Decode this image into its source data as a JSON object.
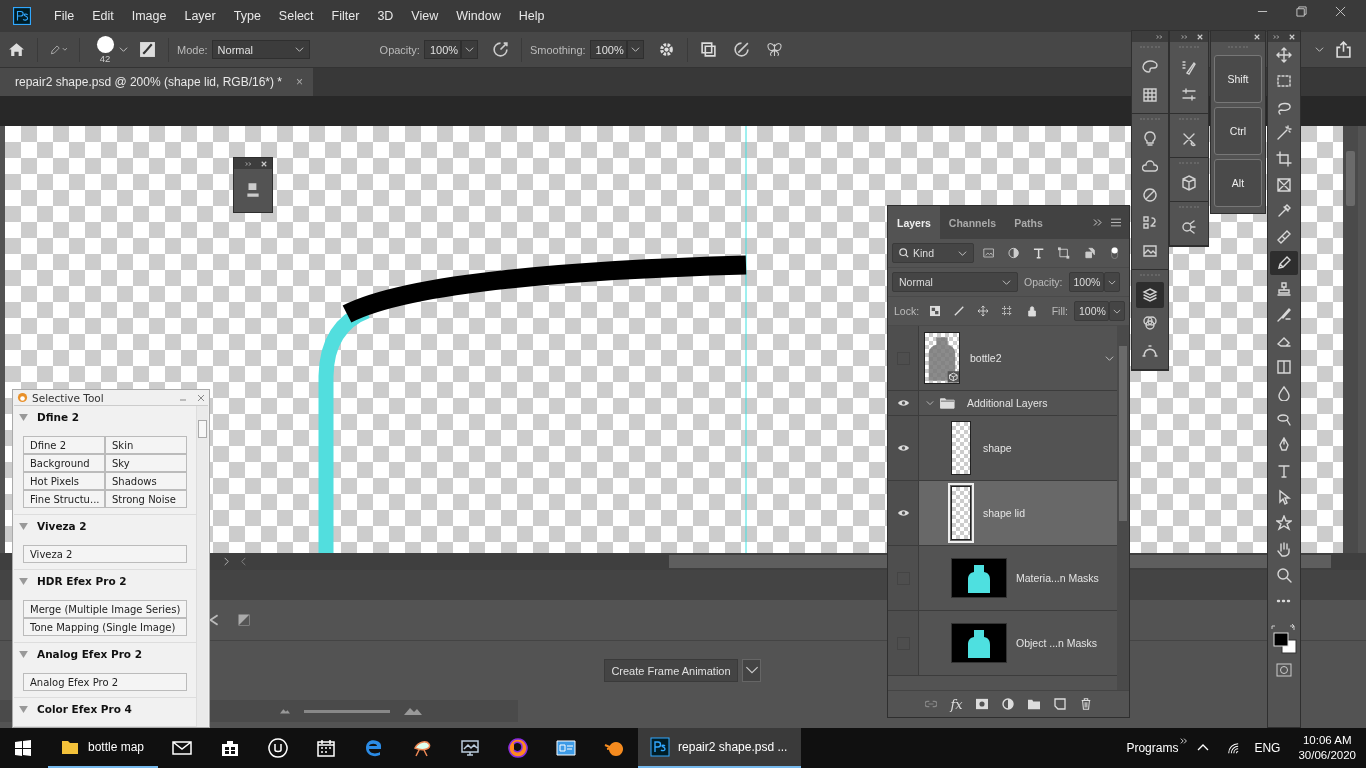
{
  "menu": [
    "File",
    "Edit",
    "Image",
    "Layer",
    "Type",
    "Select",
    "Filter",
    "3D",
    "View",
    "Window",
    "Help"
  ],
  "options_bar": {
    "brush_size": "42",
    "mode_label": "Mode:",
    "mode": "Normal",
    "opacity_label": "Opacity:",
    "opacity": "100%",
    "smoothing_label": "Smoothing:",
    "smoothing": "100%"
  },
  "document_tab": {
    "title": "repair2 shape.psd @ 200% (shape lid, RGB/16*) *",
    "close": "×"
  },
  "timeline": {
    "button": "Create Frame Animation",
    "zoom_slider": {
      "level": 1
    }
  },
  "selective_tool": {
    "title": "Selective Tool",
    "sections": [
      {
        "name": "Dfine 2",
        "buttons": [
          "Dfine 2",
          "Skin",
          "Background",
          "Sky",
          "Hot Pixels",
          "Shadows",
          "Fine Structu...",
          "Strong Noise"
        ]
      },
      {
        "name": "Viveza 2",
        "buttons": [
          "Viveza 2"
        ]
      },
      {
        "name": "HDR Efex Pro 2",
        "buttons": [
          "Merge (Multiple Image Series)",
          "Tone Mapping (Single Image)"
        ]
      },
      {
        "name": "Analog Efex Pro 2",
        "buttons": [
          "Analog Efex Pro 2"
        ]
      },
      {
        "name": "Color Efex Pro 4"
      }
    ]
  },
  "layers_panel": {
    "tabs": [
      {
        "label": "Layers",
        "selected": true
      },
      {
        "label": "Channels",
        "selected": false
      },
      {
        "label": "Paths",
        "selected": false
      }
    ],
    "filter": "Kind",
    "blend_mode": "Normal",
    "opacity_label": "Opacity:",
    "opacity": "100%",
    "lock_label": "Lock:",
    "fill_label": "Fill:",
    "fill": "100%",
    "footer_fx": "fx",
    "layers": [
      {
        "name": "bottle2",
        "kind": "smart",
        "visible": false,
        "selected": false
      },
      {
        "name": "Additional Layers",
        "kind": "group",
        "visible": true,
        "expanded": true,
        "selected": false,
        "children": [
          {
            "name": "shape",
            "kind": "pixel",
            "visible": true,
            "selected": false
          },
          {
            "name": "shape lid",
            "kind": "pixel",
            "visible": true,
            "selected": true
          },
          {
            "name": "Materia...n Masks",
            "kind": "mask",
            "visible": false,
            "selected": false
          },
          {
            "name": "Object ...n Masks",
            "kind": "mask",
            "visible": false,
            "selected": false
          }
        ]
      }
    ]
  },
  "panel_dock": {
    "column_1": [
      {
        "icons": [
          {
            "kind": "palette",
            "selected": false
          },
          {
            "kind": "grid",
            "selected": false
          }
        ]
      },
      {
        "icons": [
          {
            "kind": "bulb",
            "selected": false
          },
          {
            "kind": "cloud",
            "selected": false
          },
          {
            "kind": "halfcircle",
            "selected": false
          },
          {
            "kind": "history",
            "selected": false
          },
          {
            "kind": "picture",
            "selected": false
          }
        ]
      },
      {
        "icons": [
          {
            "kind": "layers",
            "selected": true
          },
          {
            "kind": "channels",
            "selected": false
          },
          {
            "kind": "paths",
            "selected": false
          }
        ]
      }
    ],
    "column_2": [
      {
        "icons": [
          {
            "kind": "brushlist",
            "selected": false
          },
          {
            "kind": "sliders",
            "selected": false
          }
        ]
      },
      {
        "icons": [
          {
            "kind": "tools",
            "selected": false
          }
        ]
      },
      {
        "icons": [
          {
            "kind": "cube",
            "selected": false
          }
        ]
      },
      {
        "icons": [
          {
            "kind": "network",
            "selected": false
          }
        ]
      }
    ]
  },
  "modifier_keys": [
    "Shift",
    "Ctrl",
    "Alt"
  ],
  "toolbar": {
    "tools": [
      {
        "kind": "move",
        "selected": false
      },
      {
        "kind": "marquee",
        "selected": false
      },
      {
        "kind": "lasso",
        "selected": false
      },
      {
        "kind": "wand",
        "selected": false
      },
      {
        "kind": "crop",
        "selected": false
      },
      {
        "kind": "frame",
        "selected": false
      },
      {
        "kind": "eyedropper",
        "selected": false
      },
      {
        "kind": "healing",
        "selected": false
      },
      {
        "kind": "pencil",
        "selected": true
      },
      {
        "kind": "stamp",
        "selected": false
      },
      {
        "kind": "historybrush",
        "selected": false
      },
      {
        "kind": "eraser",
        "selected": false
      },
      {
        "kind": "gradient",
        "selected": false
      },
      {
        "kind": "drop",
        "selected": false
      },
      {
        "kind": "dodge",
        "selected": false
      },
      {
        "kind": "pen",
        "selected": false
      },
      {
        "kind": "type",
        "selected": false
      },
      {
        "kind": "arrow",
        "selected": false
      },
      {
        "kind": "star",
        "selected": false
      },
      {
        "kind": "hand",
        "selected": false
      },
      {
        "kind": "zoom",
        "selected": false
      },
      {
        "kind": "more",
        "selected": false
      }
    ]
  },
  "taskbar": {
    "apps": [
      {
        "kind": "folder",
        "label": "bottle map",
        "running": true,
        "selected": false
      },
      {
        "kind": "mail",
        "running": false,
        "selected": false
      },
      {
        "kind": "store",
        "running": false,
        "selected": false
      },
      {
        "kind": "unreal",
        "running": false,
        "selected": false
      },
      {
        "kind": "calendar",
        "running": false,
        "selected": false
      },
      {
        "kind": "edge",
        "running": false,
        "selected": false
      },
      {
        "kind": "snip",
        "running": false,
        "selected": false
      },
      {
        "kind": "monitor",
        "running": false,
        "selected": false
      },
      {
        "kind": "firefox",
        "running": false,
        "selected": false
      },
      {
        "kind": "card",
        "running": false,
        "selected": false
      },
      {
        "kind": "blender",
        "running": false,
        "selected": false
      },
      {
        "kind": "ps",
        "label": "repair2 shape.psd ...",
        "running": true,
        "selected": true
      }
    ],
    "programs": "Programs",
    "language": "ENG",
    "time": "10:06 AM",
    "date": "30/06/2020"
  }
}
